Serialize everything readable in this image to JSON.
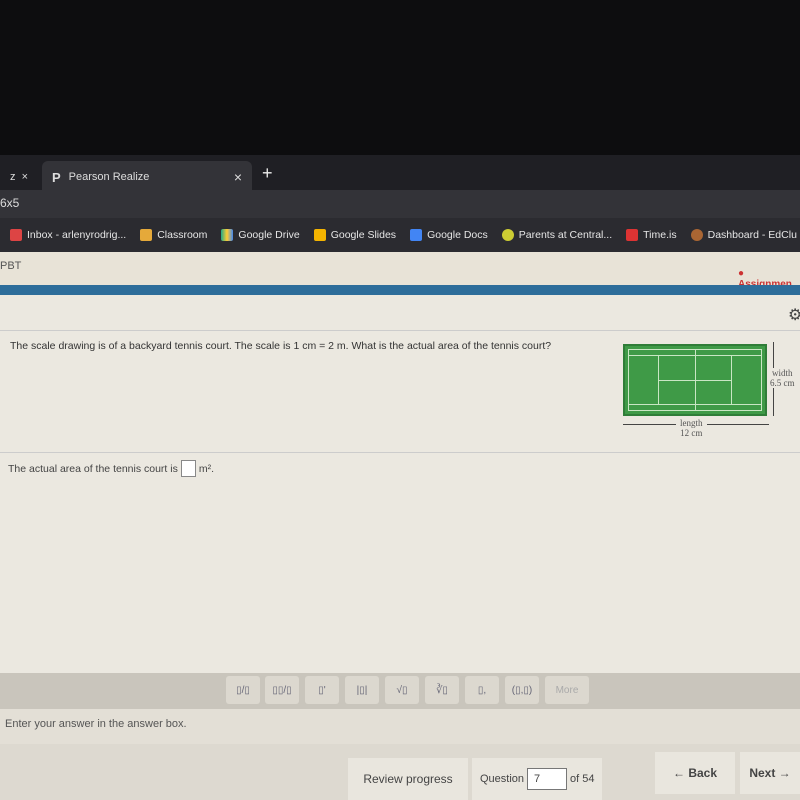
{
  "browser": {
    "tabs": [
      {
        "label": "z"
      },
      {
        "label": "Pearson Realize",
        "icon": "P"
      }
    ],
    "new_tab": "+",
    "close": "×",
    "address": "6x5",
    "bookmarks": [
      "Inbox - arlenyrodrig...",
      "Classroom",
      "Google Drive",
      "Google Slides",
      "Google Docs",
      "Parents at Central...",
      "Time.is",
      "Dashboard - EdClu"
    ]
  },
  "header": {
    "left": "PBT",
    "assignment": "Assignmen"
  },
  "question": {
    "text": "The scale drawing is of a backyard tennis court. The scale is 1 cm = 2 m. What is the actual area of the tennis court?",
    "width_label": "width",
    "width_value": "6.5 cm",
    "length_label": "length",
    "length_value": "12 cm"
  },
  "answer": {
    "prefix": "The actual area of the tennis court is",
    "value": "",
    "unit": "m²."
  },
  "toolbar": {
    "buttons": [
      "▯/▯",
      "▯▯/▯",
      "▯'",
      "|▯|",
      "√▯",
      "∛▯",
      "▯,",
      "(▯,▯)",
      "More"
    ]
  },
  "instruction": "Enter your answer in the answer box.",
  "footer": {
    "review": "Review progress",
    "question_label": "Question",
    "question_number": "7",
    "of": "of 54",
    "back": "← Back",
    "next": "Next →"
  }
}
